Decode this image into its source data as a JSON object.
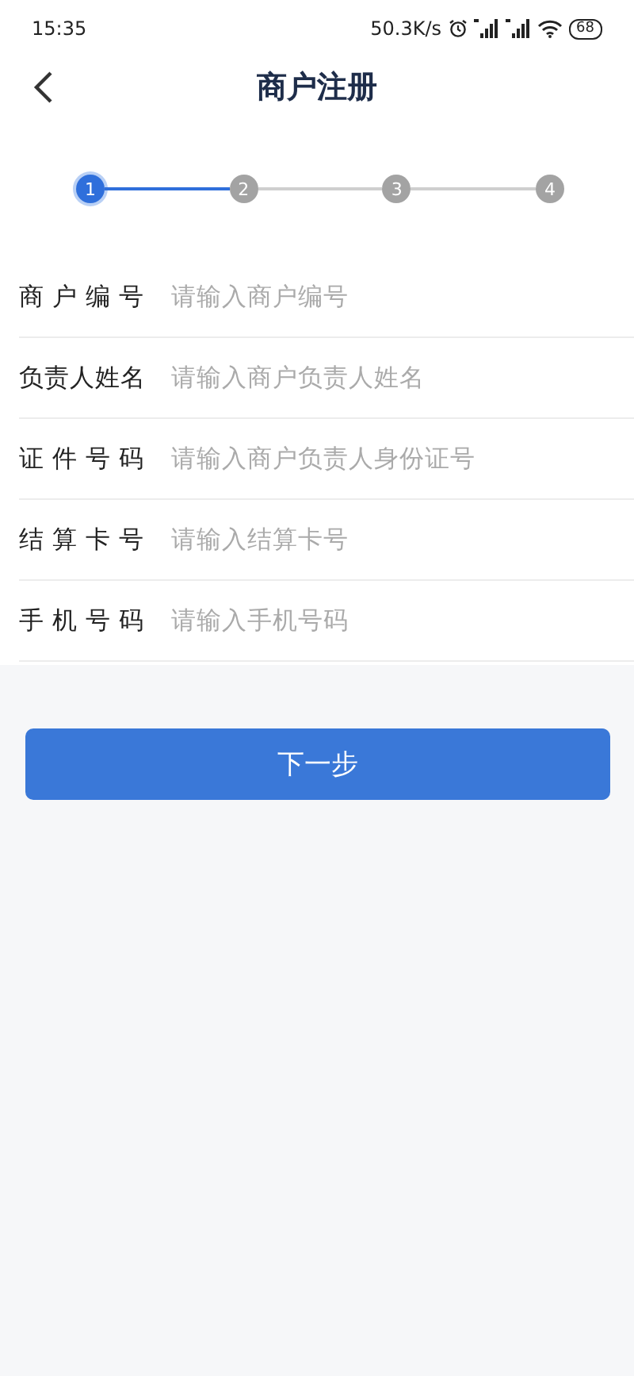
{
  "status_bar": {
    "time": "15:35",
    "speed": "50.3K/s",
    "battery": "68"
  },
  "header": {
    "title": "商户注册"
  },
  "steps": [
    {
      "label": "1",
      "selected": true
    },
    {
      "label": "2",
      "selected": false
    },
    {
      "label": "3",
      "selected": false
    },
    {
      "label": "4",
      "selected": false
    }
  ],
  "fields": [
    {
      "label": "商 户 编 号",
      "placeholder": "请输入商户编号"
    },
    {
      "label": "负责人姓名",
      "placeholder": "请输入商户负责人姓名"
    },
    {
      "label": "证 件 号 码",
      "placeholder": "请输入商户负责人身份证号"
    },
    {
      "label": "结 算 卡 号",
      "placeholder": "请输入结算卡号"
    },
    {
      "label": "手 机 号 码",
      "placeholder": "请输入手机号码"
    }
  ],
  "next_button": "下一步"
}
